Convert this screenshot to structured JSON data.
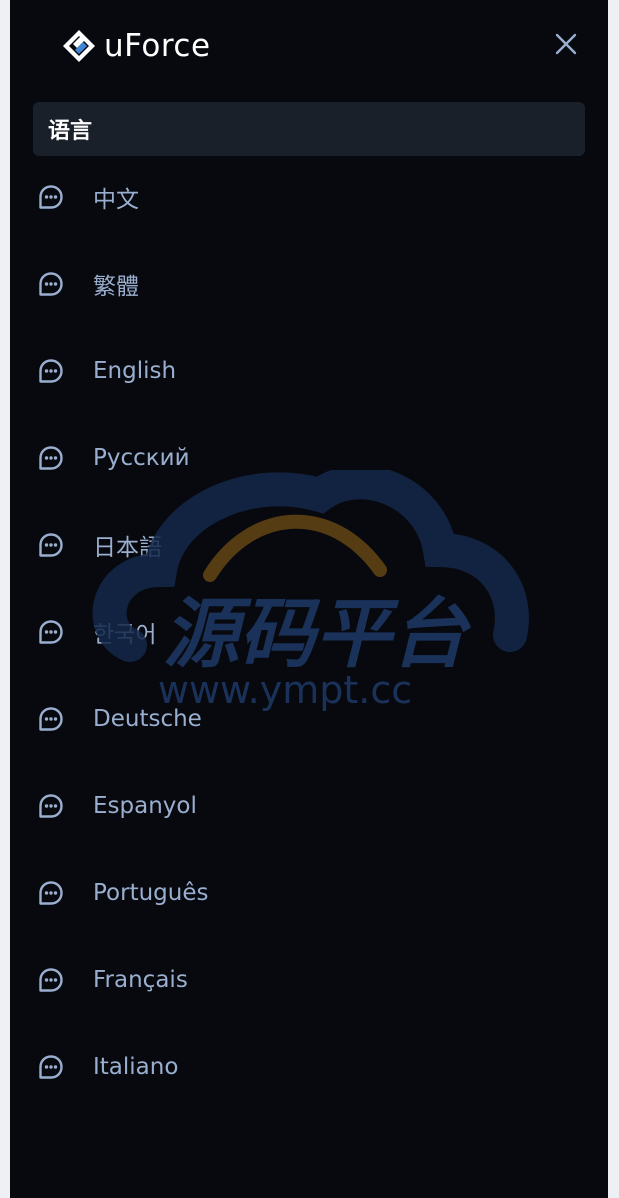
{
  "app": {
    "brand_name": "uForce"
  },
  "menu": {
    "section_title": "语言",
    "languages": [
      {
        "label": "中文"
      },
      {
        "label": "繁體"
      },
      {
        "label": "English"
      },
      {
        "label": "Pусский"
      },
      {
        "label": "日本語"
      },
      {
        "label": "한국어"
      },
      {
        "label": "Deutsche"
      },
      {
        "label": "Espanyol"
      },
      {
        "label": "Português"
      },
      {
        "label": "Français"
      },
      {
        "label": "Italiano"
      }
    ]
  },
  "watermark": {
    "title": "源码平台",
    "url": "www.ympt.cc"
  },
  "icons": {
    "logo": "diamond-logo-icon",
    "close": "close-icon",
    "language_item": "chat-bubble-icon"
  },
  "colors": {
    "panel_background": "#07090e",
    "section_background": "#1a202a",
    "item_text": "#9aafcf",
    "icon": "#9aafcf",
    "title_text": "#ffffff",
    "logo_blue": "#3f87d6"
  }
}
